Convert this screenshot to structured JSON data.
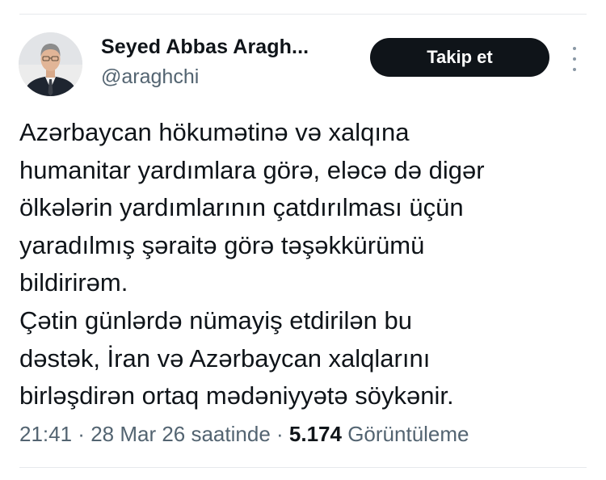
{
  "author": {
    "display_name": "Seyed Abbas Aragh...",
    "handle": "@araghchi"
  },
  "follow_button": {
    "label": "Takip et"
  },
  "more_menu": {
    "icon": "more-vertical-icon"
  },
  "tweet": {
    "lines": [
      "Azərbaycan hökumətinə və xalqına",
      "humanitar yardımlara görə, eləcə də digər",
      "ölkələrin yardımlarının çatdırılması üçün",
      "yaradılmış şəraitə görə təşəkkürümü",
      "bildirirəm.",
      "Çətin günlərdə nümayiş etdirilən bu",
      "dəstək, İran və Azərbaycan xalqlarını",
      "birləşdirən ortaq mədəniyyətə söykənir."
    ]
  },
  "meta": {
    "time": "21:41",
    "separator": " · ",
    "date": "28 Mar 26 saatinde",
    "views_count": "5.174",
    "views_label": "Görüntüleme"
  },
  "colors": {
    "text_primary": "#0f1419",
    "text_secondary": "#536471",
    "button_bg": "#0f1419",
    "button_text": "#ffffff",
    "divider": "#e6e9ec"
  }
}
